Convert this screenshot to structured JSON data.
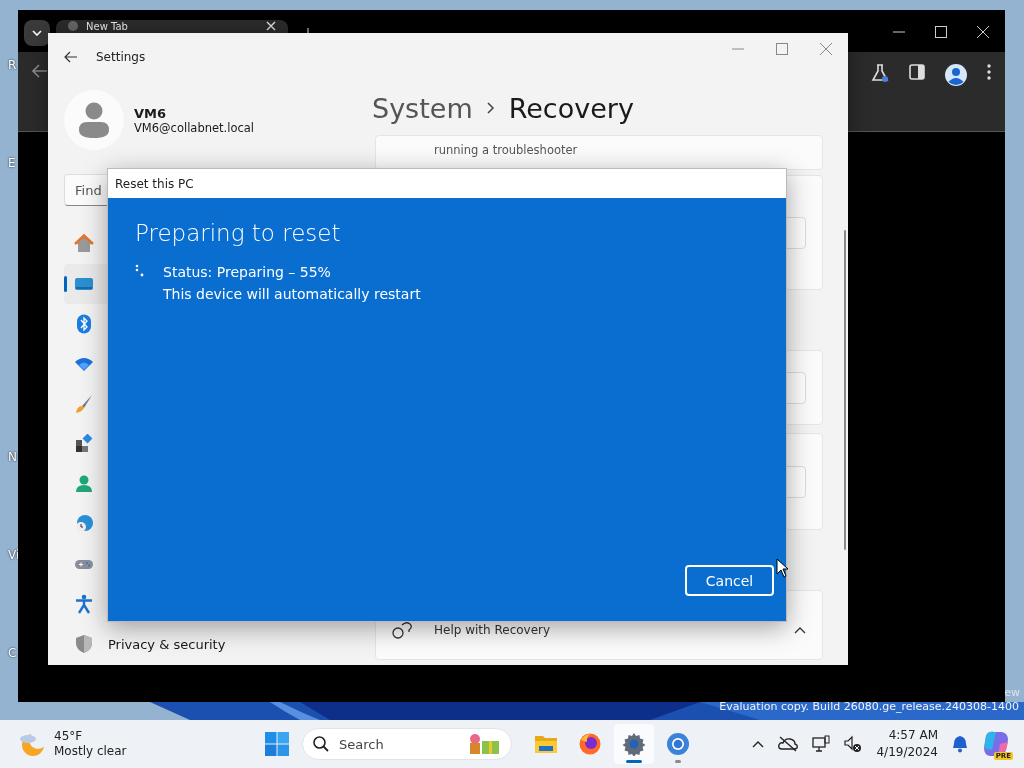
{
  "desktop": {
    "icon_labels": [
      "R",
      "E",
      "N",
      "Vi",
      "C"
    ],
    "watermark_fragment": "ew",
    "watermark": "Evaluation copy. Build 26080.ge_release.240308-1400"
  },
  "browser": {
    "tabs": [
      {
        "title": "New Tab"
      }
    ]
  },
  "settings": {
    "title": "Settings",
    "user": {
      "name": "VM6",
      "email": "VM6@collabnet.local"
    },
    "search": {
      "placeholder": "Find"
    },
    "nav": [
      {
        "kind": "home",
        "selected": false
      },
      {
        "kind": "system",
        "selected": true
      },
      {
        "kind": "bluetooth",
        "selected": false
      },
      {
        "kind": "network",
        "selected": false
      },
      {
        "kind": "personalization",
        "selected": false
      },
      {
        "kind": "apps",
        "selected": false
      },
      {
        "kind": "accounts",
        "selected": false
      },
      {
        "kind": "time",
        "selected": false
      },
      {
        "kind": "gaming",
        "selected": false
      },
      {
        "kind": "accessibility",
        "selected": false
      },
      {
        "kind": "privacy",
        "label": "Privacy & security",
        "selected": false
      }
    ],
    "breadcrumb": {
      "parent": "System",
      "current": "Recovery"
    },
    "cards": [
      {
        "kind": "text",
        "text": "running a troubleshooter"
      },
      {
        "kind": "button"
      },
      {
        "kind": "button"
      },
      {
        "kind": "button"
      },
      {
        "kind": "expander",
        "text": "Help with Recovery",
        "expanded": true
      }
    ]
  },
  "dialog": {
    "title": "Reset this PC",
    "heading": "Preparing to reset",
    "status": "Status: Preparing – 55%",
    "note": "This device will automatically restart",
    "buttons": [
      "Cancel"
    ]
  },
  "taskbar": {
    "weather": {
      "temperature": "45°F",
      "condition": "Mostly clear"
    },
    "search": {
      "placeholder": "Search"
    },
    "apps": [
      {
        "kind": "explorer",
        "running": false,
        "active": false
      },
      {
        "kind": "firefox",
        "running": false,
        "active": false
      },
      {
        "kind": "settings",
        "running": true,
        "active": true
      },
      {
        "kind": "chrome",
        "running": true,
        "active": false
      }
    ],
    "clock": {
      "time": "4:57 AM",
      "date": "4/19/2024"
    },
    "copilot_badge": "PRE"
  }
}
